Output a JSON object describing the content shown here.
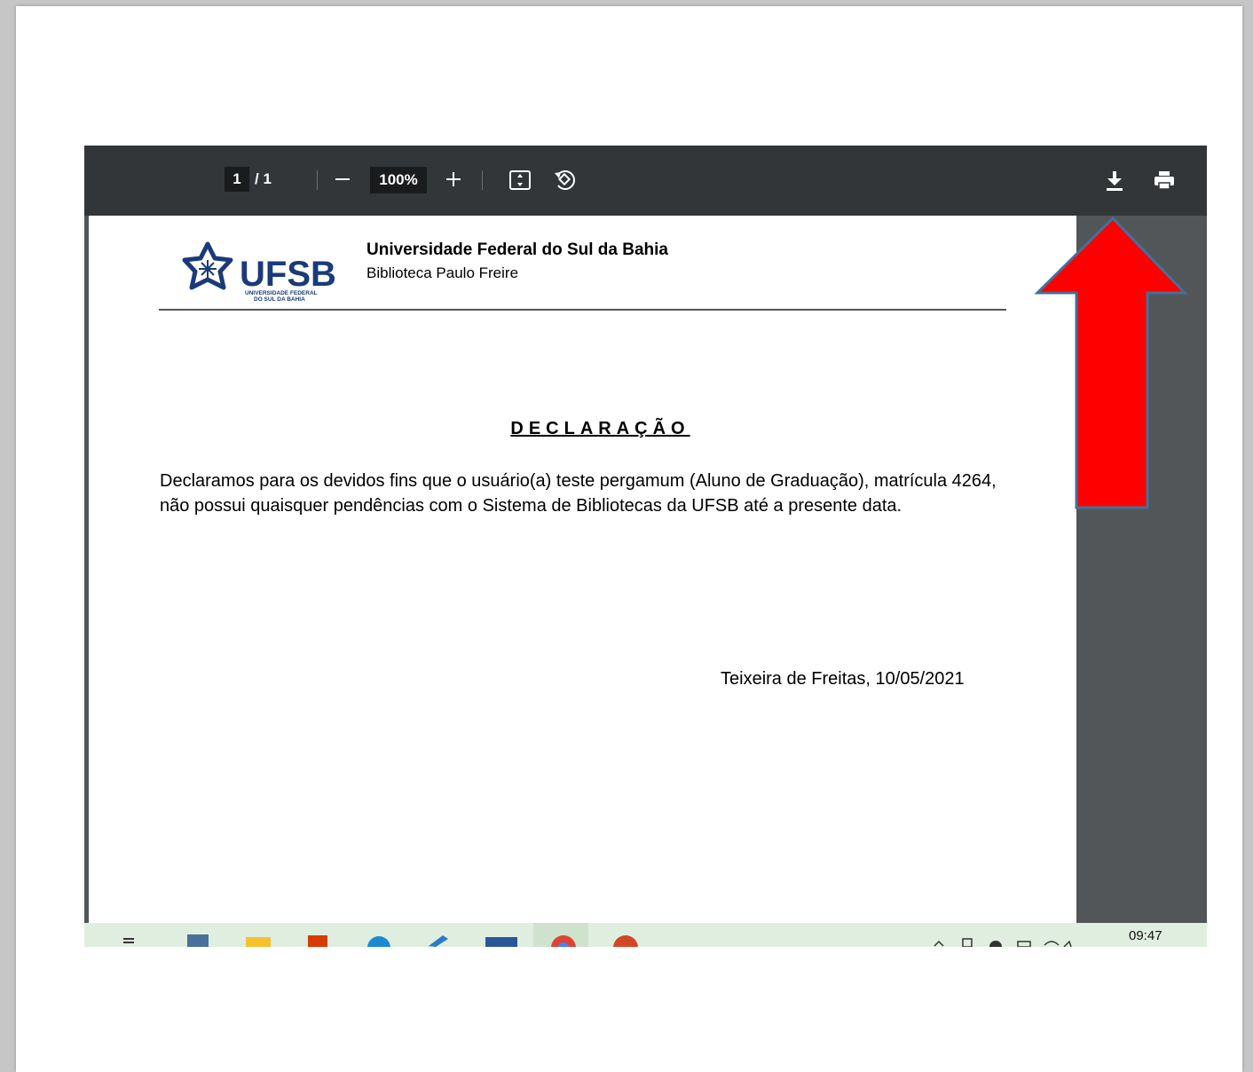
{
  "toolbar": {
    "current_page": "1",
    "page_total": "/ 1",
    "zoom": "100%",
    "icons": [
      "zoom-out-icon",
      "zoom-in-icon",
      "fit-to-page-icon",
      "rotate-icon",
      "download-icon",
      "print-icon"
    ]
  },
  "document": {
    "logo_text": "UFSB",
    "logo_subtext_1": "UNIVERSIDADE FEDERAL",
    "logo_subtext_2": "DO SUL DA BAHIA",
    "university": "Universidade Federal do Sul da Bahia",
    "library": "Biblioteca Paulo Freire",
    "title": "DECLARAÇÃO",
    "body": "Declaramos para os devidos fins que o usuário(a) teste pergamum (Aluno de Graduação), matrícula 4264, não possui quaisquer pendências com o Sistema de Bibliotecas da UFSB até a presente data.",
    "place_date": "Teixeira de Freitas, 10/05/2021"
  },
  "taskbar": {
    "clock": "09:47"
  },
  "annotation": {
    "arrow_color": "#ff0000",
    "arrow_outline": "#41719c"
  },
  "colors": {
    "toolbar_bg": "#323639",
    "viewer_bg": "#525659",
    "logo_blue": "#1b3a7a"
  }
}
